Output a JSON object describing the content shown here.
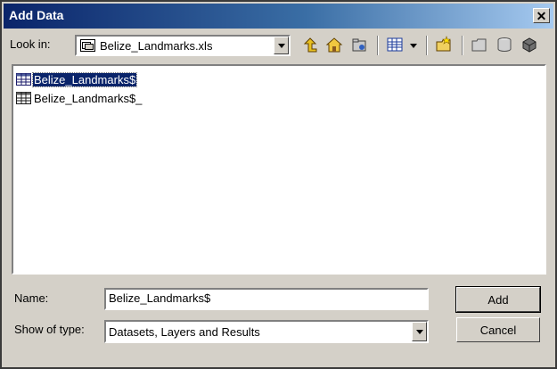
{
  "window": {
    "title": "Add Data",
    "close_glyph": "✕"
  },
  "lookin": {
    "label": "Look in:",
    "value": "Belize_Landmarks.xls"
  },
  "toolbar": {
    "icons": [
      "up-one-level-icon",
      "home-icon",
      "connect-folder-icon",
      "view-options-icon",
      "new-folder-icon",
      "new-file-geodatabase-icon",
      "new-personal-geodatabase-icon",
      "toolbox-icon"
    ]
  },
  "list": {
    "items": [
      {
        "label": "Belize_Landmarks$",
        "selected": true
      },
      {
        "label": "Belize_Landmarks$_",
        "selected": false
      }
    ]
  },
  "name": {
    "label": "Name:",
    "value": "Belize_Landmarks$"
  },
  "type": {
    "label": "Show of type:",
    "value": "Datasets, Layers and Results"
  },
  "buttons": {
    "add": "Add",
    "cancel": "Cancel"
  },
  "colors": {
    "title_start": "#0a246a",
    "title_end": "#a6caf0",
    "dialog": "#d4d0c8",
    "selection": "#0a246a"
  }
}
